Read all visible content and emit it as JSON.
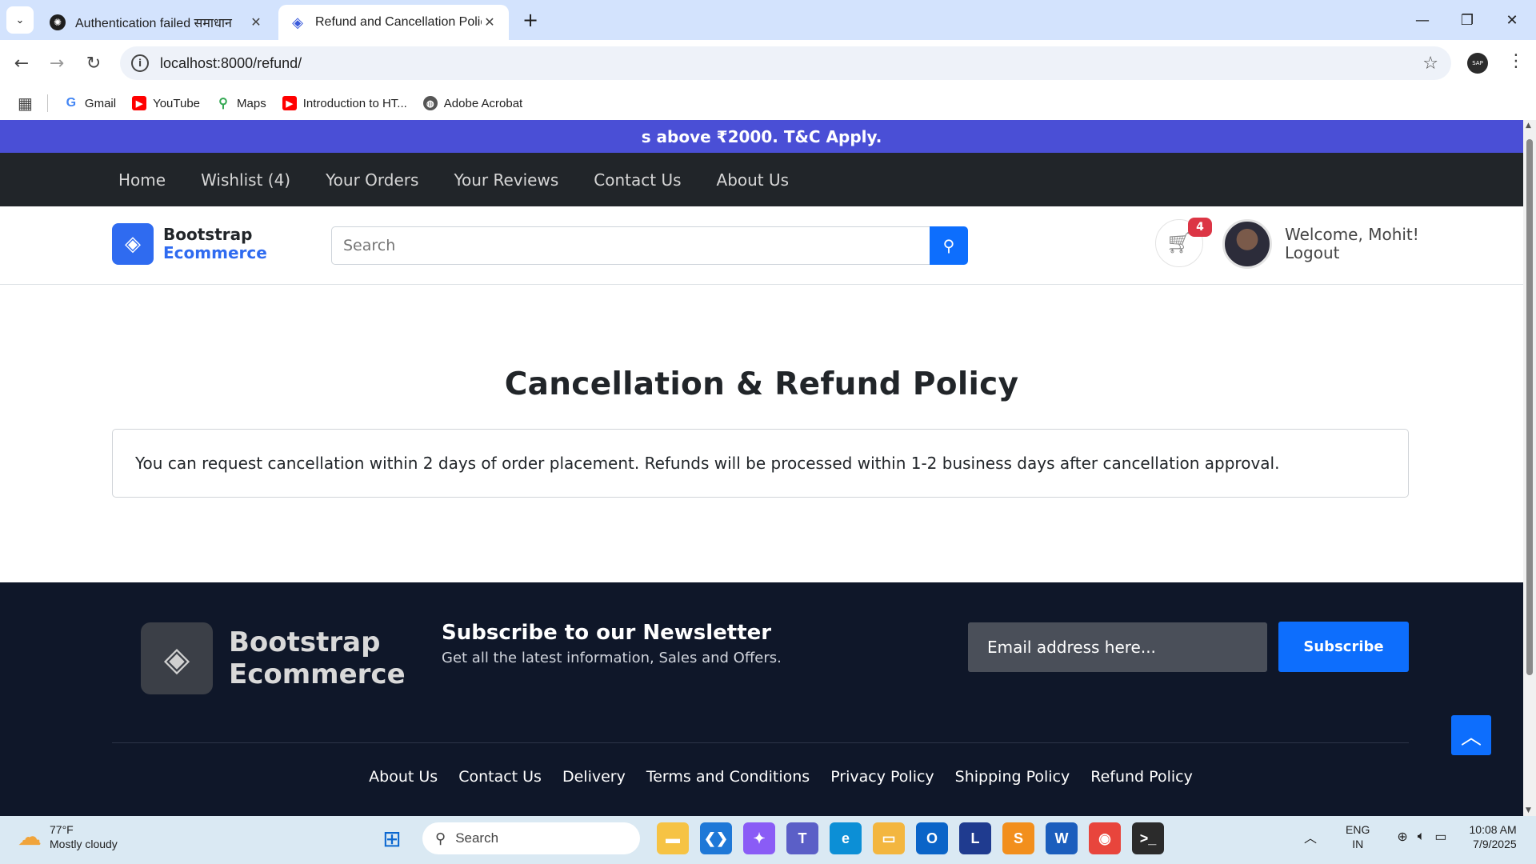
{
  "browser": {
    "tabs": [
      {
        "title": "Authentication failed समाधान",
        "active": false
      },
      {
        "title": "Refund and Cancellation Policy",
        "active": true
      }
    ],
    "url": "localhost:8000/refund/",
    "profile_label": "SAP",
    "bookmarks": [
      {
        "label": "Gmail",
        "icon": "google-icon",
        "color": "#4285f4"
      },
      {
        "label": "YouTube",
        "icon": "youtube-icon",
        "color": "#ff0000"
      },
      {
        "label": "Maps",
        "icon": "maps-pin-icon",
        "color": "#34a853"
      },
      {
        "label": "Introduction to HT...",
        "icon": "youtube-icon",
        "color": "#ff0000"
      },
      {
        "label": "Adobe Acrobat",
        "icon": "globe-icon",
        "color": "#555555"
      }
    ]
  },
  "page": {
    "promo_text": "s above ₹2000. T&C Apply.",
    "nav": [
      "Home",
      "Wishlist (4)",
      "Your Orders",
      "Your Reviews",
      "Contact Us",
      "About Us"
    ],
    "logo": {
      "line1": "Bootstrap",
      "line2": "Ecommerce"
    },
    "search_placeholder": "Search",
    "cart_count": "4",
    "welcome": "Welcome, Mohit!",
    "logout": "Logout",
    "title": "Cancellation & Refund Policy",
    "policy_text": "You can request cancellation within 2 days of order placement. Refunds will be processed within 1-2 business days after cancellation approval.",
    "footer": {
      "logo_line1": "Bootstrap",
      "logo_line2": "Ecommerce",
      "newsletter_title": "Subscribe to our Newsletter",
      "newsletter_sub": "Get all the latest information, Sales and Offers.",
      "email_placeholder": "Email address here...",
      "subscribe_label": "Subscribe",
      "links": [
        "About Us",
        "Contact Us",
        "Delivery",
        "Terms and Conditions",
        "Privacy Policy",
        "Shipping Policy",
        "Refund Policy"
      ]
    },
    "colors": {
      "accent": "#0d6efd",
      "promo": "#4a4fd6",
      "nav_bg": "#212529",
      "footer_bg": "#0f1729",
      "badge": "#dc3545"
    }
  },
  "taskbar": {
    "weather_temp": "77°F",
    "weather_desc": "Mostly cloudy",
    "search_label": "Search",
    "lang1": "ENG",
    "lang2": "IN",
    "time": "10:08 AM",
    "date": "7/9/2025",
    "apps": [
      {
        "name": "file-explorer-icon",
        "color": "#f6c344",
        "glyph": "▬"
      },
      {
        "name": "vscode-icon",
        "color": "#1e78d7",
        "glyph": "❮❯"
      },
      {
        "name": "copilot-icon",
        "color": "#8a5cf6",
        "glyph": "✦"
      },
      {
        "name": "teams-icon",
        "color": "#5b5fc7",
        "glyph": "T"
      },
      {
        "name": "edge-icon",
        "color": "#0c8fd6",
        "glyph": "e"
      },
      {
        "name": "folder-icon",
        "color": "#f3b63f",
        "glyph": "▭"
      },
      {
        "name": "outlook-icon",
        "color": "#0a64c8",
        "glyph": "O"
      },
      {
        "name": "l-app-icon",
        "color": "#1f3b8f",
        "glyph": "L"
      },
      {
        "name": "sublime-icon",
        "color": "#f28f1d",
        "glyph": "S"
      },
      {
        "name": "word-icon",
        "color": "#1b5ebd",
        "glyph": "W"
      },
      {
        "name": "chrome-icon",
        "color": "#e8453c",
        "glyph": "◉"
      },
      {
        "name": "terminal-icon",
        "color": "#2b2b2b",
        "glyph": ">_"
      }
    ]
  }
}
